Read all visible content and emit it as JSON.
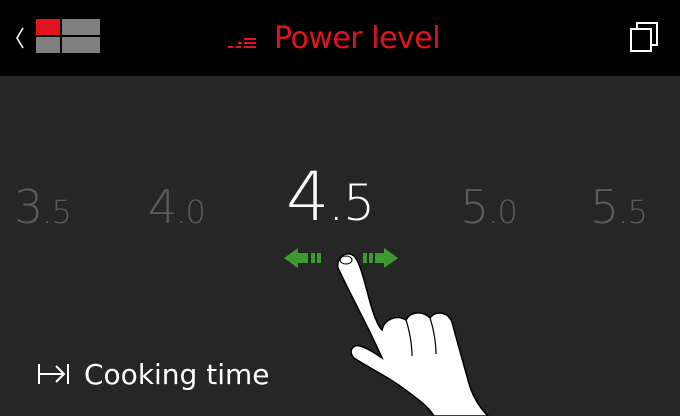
{
  "header": {
    "title": "Power level",
    "back_icon": "chevron-left-icon",
    "zones_icon": "cooking-zones-icon",
    "title_icon": "power-level-icon",
    "windows_icon": "multi-window-icon",
    "accent_color": "#e0141e"
  },
  "selector": {
    "levels": [
      {
        "int": "3",
        "frac": ".5"
      },
      {
        "int": "4",
        "frac": ".0"
      },
      {
        "int": "4",
        "frac": ".5"
      },
      {
        "int": "5",
        "frac": ".0"
      },
      {
        "int": "5",
        "frac": ".5"
      }
    ],
    "selected_index": 2,
    "hint_icon": "swipe-left-right-icon",
    "hint_color": "#3c9a2f"
  },
  "footer": {
    "cooking_time_label": "Cooking time",
    "cooking_time_icon": "timer-end-icon"
  }
}
